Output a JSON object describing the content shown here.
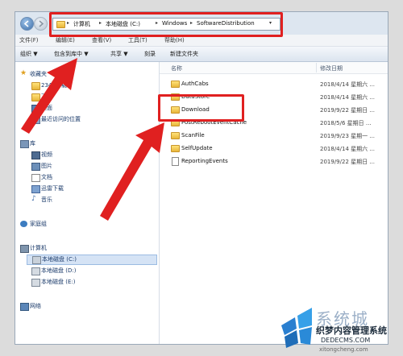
{
  "address": {
    "crumbs": [
      "计算机",
      "本地磁盘 (C:)",
      "Windows",
      "SoftwareDistribution"
    ]
  },
  "menu": [
    "文件(F)",
    "编辑(E)",
    "查看(V)",
    "工具(T)",
    "帮助(H)"
  ],
  "toolbar": {
    "organize": "组织 ▼",
    "include": "包含到库中 ▼",
    "share": "共享 ▼",
    "burn": "刻录",
    "newfolder": "新建文件夹"
  },
  "nav": {
    "favorites": "收藏夹",
    "fav_items": [
      "2345下载",
      "下载",
      "桌面",
      "最近访问的位置"
    ],
    "library": "库",
    "lib_items": [
      "视频",
      "图片",
      "文档",
      "迅雷下载",
      "音乐"
    ],
    "homegroup": "家庭组",
    "computer": "计算机",
    "drives": [
      "本地磁盘 (C:)",
      "本地磁盘 (D:)",
      "本地磁盘 (E:)"
    ],
    "network": "网络"
  },
  "columns": {
    "name": "名称",
    "date": "修改日期"
  },
  "files": [
    {
      "name": "AuthCabs",
      "date": "2018/4/14 星期六 ..."
    },
    {
      "name": "DataStore",
      "date": "2018/4/14 星期六 ..."
    },
    {
      "name": "Download",
      "date": "2019/9/22 星期日 ..."
    },
    {
      "name": "PostRebootEventCache",
      "date": "2018/5/6 星期日 ..."
    },
    {
      "name": "ScanFile",
      "date": "2019/9/23 星期一 ..."
    },
    {
      "name": "SelfUpdate",
      "date": "2018/4/14 星期六 ..."
    },
    {
      "name": "ReportingEvents",
      "date": "2019/9/22 星期日 ..."
    }
  ],
  "watermark": {
    "brand": "系统城",
    "cn": "织梦内容管理系统",
    "site": "DEDECMS.COM",
    "url": "xitongcheng.com"
  },
  "colors": {
    "annotation": "#e02020",
    "folder": "#f0c14b",
    "selection": "#d5e3f5"
  }
}
